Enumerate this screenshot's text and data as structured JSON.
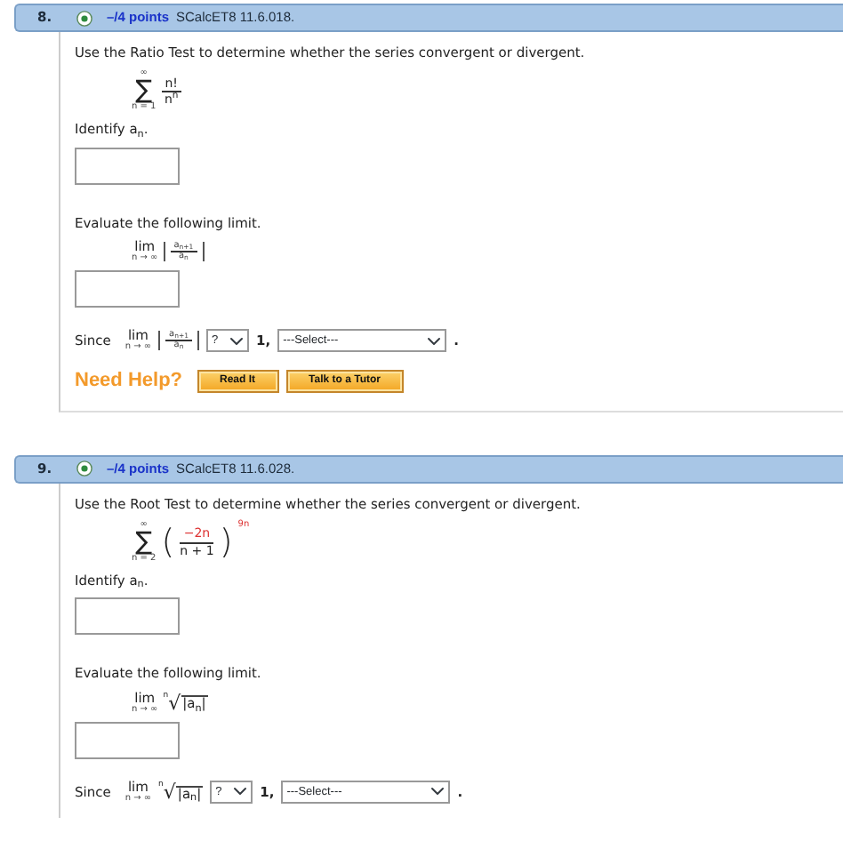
{
  "questions": [
    {
      "number": "8.",
      "points": "–/4 points",
      "source": "SCalcET8 11.6.018.",
      "instruction": "Use the Ratio Test to determine whether the series convergent or divergent.",
      "series": {
        "kind": "fraction",
        "upper": "∞",
        "sigma": "∑",
        "lower": "n = 1",
        "numerator": "n!",
        "denominator": "n$^{n}$"
      },
      "identify_label": "Identify a$_{n}$.",
      "evaluate_label": "Evaluate the following limit.",
      "limit": {
        "kind": "ratio",
        "lim": "lim",
        "under": "n → ∞",
        "numerator": "a$_{n+1}$",
        "denominator": "a$_{n}$"
      },
      "since": {
        "kind": "ratio",
        "label": "Since",
        "lim": "lim",
        "under": "n → ∞",
        "numerator": "a$_{n+1}$",
        "denominator": "a$_{n}$",
        "compare": "?",
        "one": "1,",
        "select": "---Select---",
        "end": "."
      },
      "help": {
        "label": "Need Help?",
        "buttons": [
          "Read It",
          "Talk to a Tutor"
        ]
      }
    },
    {
      "number": "9.",
      "points": "–/4 points",
      "source": "SCalcET8 11.6.028.",
      "instruction": "Use the Root Test to determine whether the series convergent or divergent.",
      "series": {
        "kind": "power",
        "upper": "∞",
        "sigma": "∑",
        "lower": "n = 2",
        "open": "(",
        "numerator": "−2n",
        "denominator": "n + 1",
        "close": ")",
        "exponent": "9n"
      },
      "identify_label": "Identify a$_{n}$.",
      "evaluate_label": "Evaluate the following limit.",
      "limit": {
        "kind": "root",
        "lim": "lim",
        "under": "n → ∞",
        "index": "n",
        "radical": "√",
        "radicand": "|a$_{n}$|"
      },
      "since": {
        "kind": "root",
        "label": "Since",
        "lim": "lim",
        "under": "n → ∞",
        "index": "n",
        "radical": "√",
        "radicand": "|a$_{n}$|",
        "compare": "?",
        "one": "1,",
        "select": "---Select---",
        "end": "."
      }
    }
  ]
}
